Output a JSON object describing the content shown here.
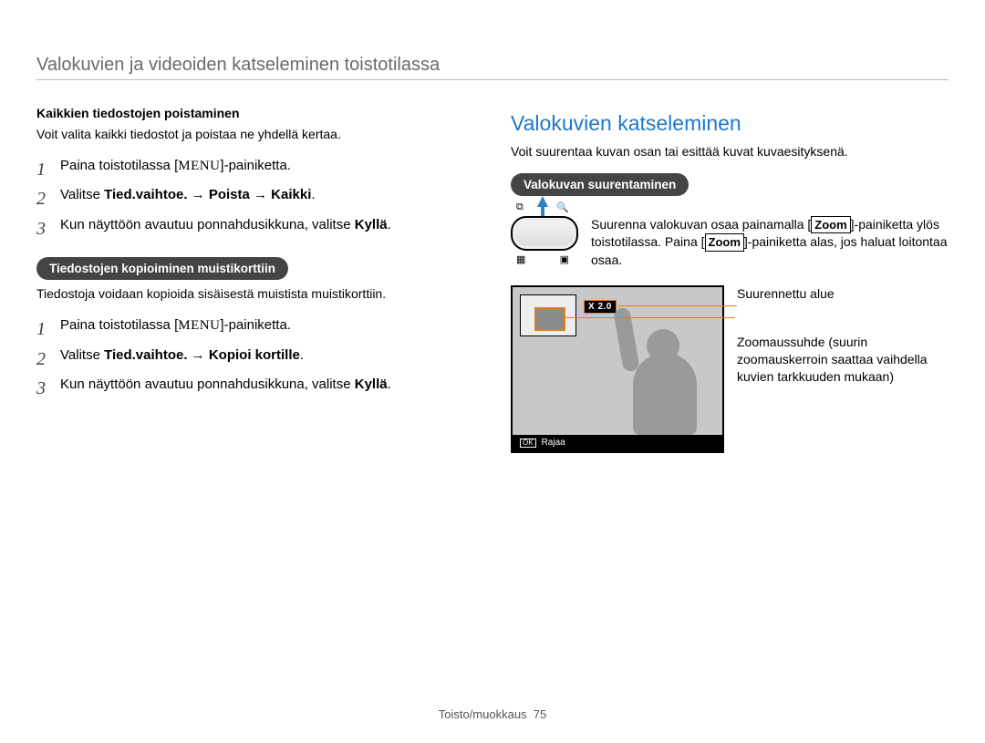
{
  "top_title": "Valokuvien ja videoiden katseleminen toistotilassa",
  "left": {
    "delete_all_heading": "Kaikkien tiedostojen poistaminen",
    "delete_all_intro": "Voit valita kaikki tiedostot ja poistaa ne yhdellä kertaa.",
    "steps_delete": [
      {
        "pre": "Paina toistotilassa [",
        "menu": "MENU",
        "post": "]-painiketta."
      },
      {
        "pre": "Valitse  ",
        "bold": "Tied.vaihtoe. → Poista → Kaikki",
        "post": "."
      },
      {
        "pre": "Kun näyttöön avautuu ponnahdusikkuna, valitse ",
        "bold": "Kyllä",
        "post": "."
      }
    ],
    "copy_pill": "Tiedostojen kopioiminen muistikorttiin",
    "copy_intro": "Tiedostoja voidaan kopioida sisäisestä muistista muistikorttiin.",
    "steps_copy": [
      {
        "pre": "Paina toistotilassa [",
        "menu": "MENU",
        "post": "]-painiketta."
      },
      {
        "pre": "Valitse ",
        "bold": "Tied.vaihtoe. → Kopioi kortille",
        "post": "."
      },
      {
        "pre": "Kun näyttöön avautuu ponnahdusikkuna, valitse ",
        "bold": "Kyllä",
        "post": "."
      }
    ]
  },
  "right": {
    "title": "Valokuvien katseleminen",
    "intro": "Voit suurentaa kuvan osan tai esittää kuvat kuvaesityksenä.",
    "zoom_pill": "Valokuvan suurentaminen",
    "zoom_top_left": "🔍₊",
    "zoom_top_right": "🔍",
    "zoom_bottom_left": "▦",
    "zoom_bottom_right": "▣",
    "zoom_desc_pre": "Suurenna valokuvan osaa painamalla [",
    "zoom_btn": "Zoom",
    "zoom_desc_mid": "]-painiketta ylös toistotilassa. Paina [",
    "zoom_desc_post": "]-painiketta alas, jos haluat loitontaa osaa.",
    "display": {
      "x_label": "X 2.0",
      "ok": "OK",
      "crop": "Rajaa"
    },
    "label_area": "Suurennettu alue",
    "label_zoom_ratio": "Zoomaussuhde (suurin zoomauskerroin saattaa vaihdella kuvien tarkkuuden mukaan)"
  },
  "footer": {
    "section": "Toisto/muokkaus",
    "page": "75"
  }
}
